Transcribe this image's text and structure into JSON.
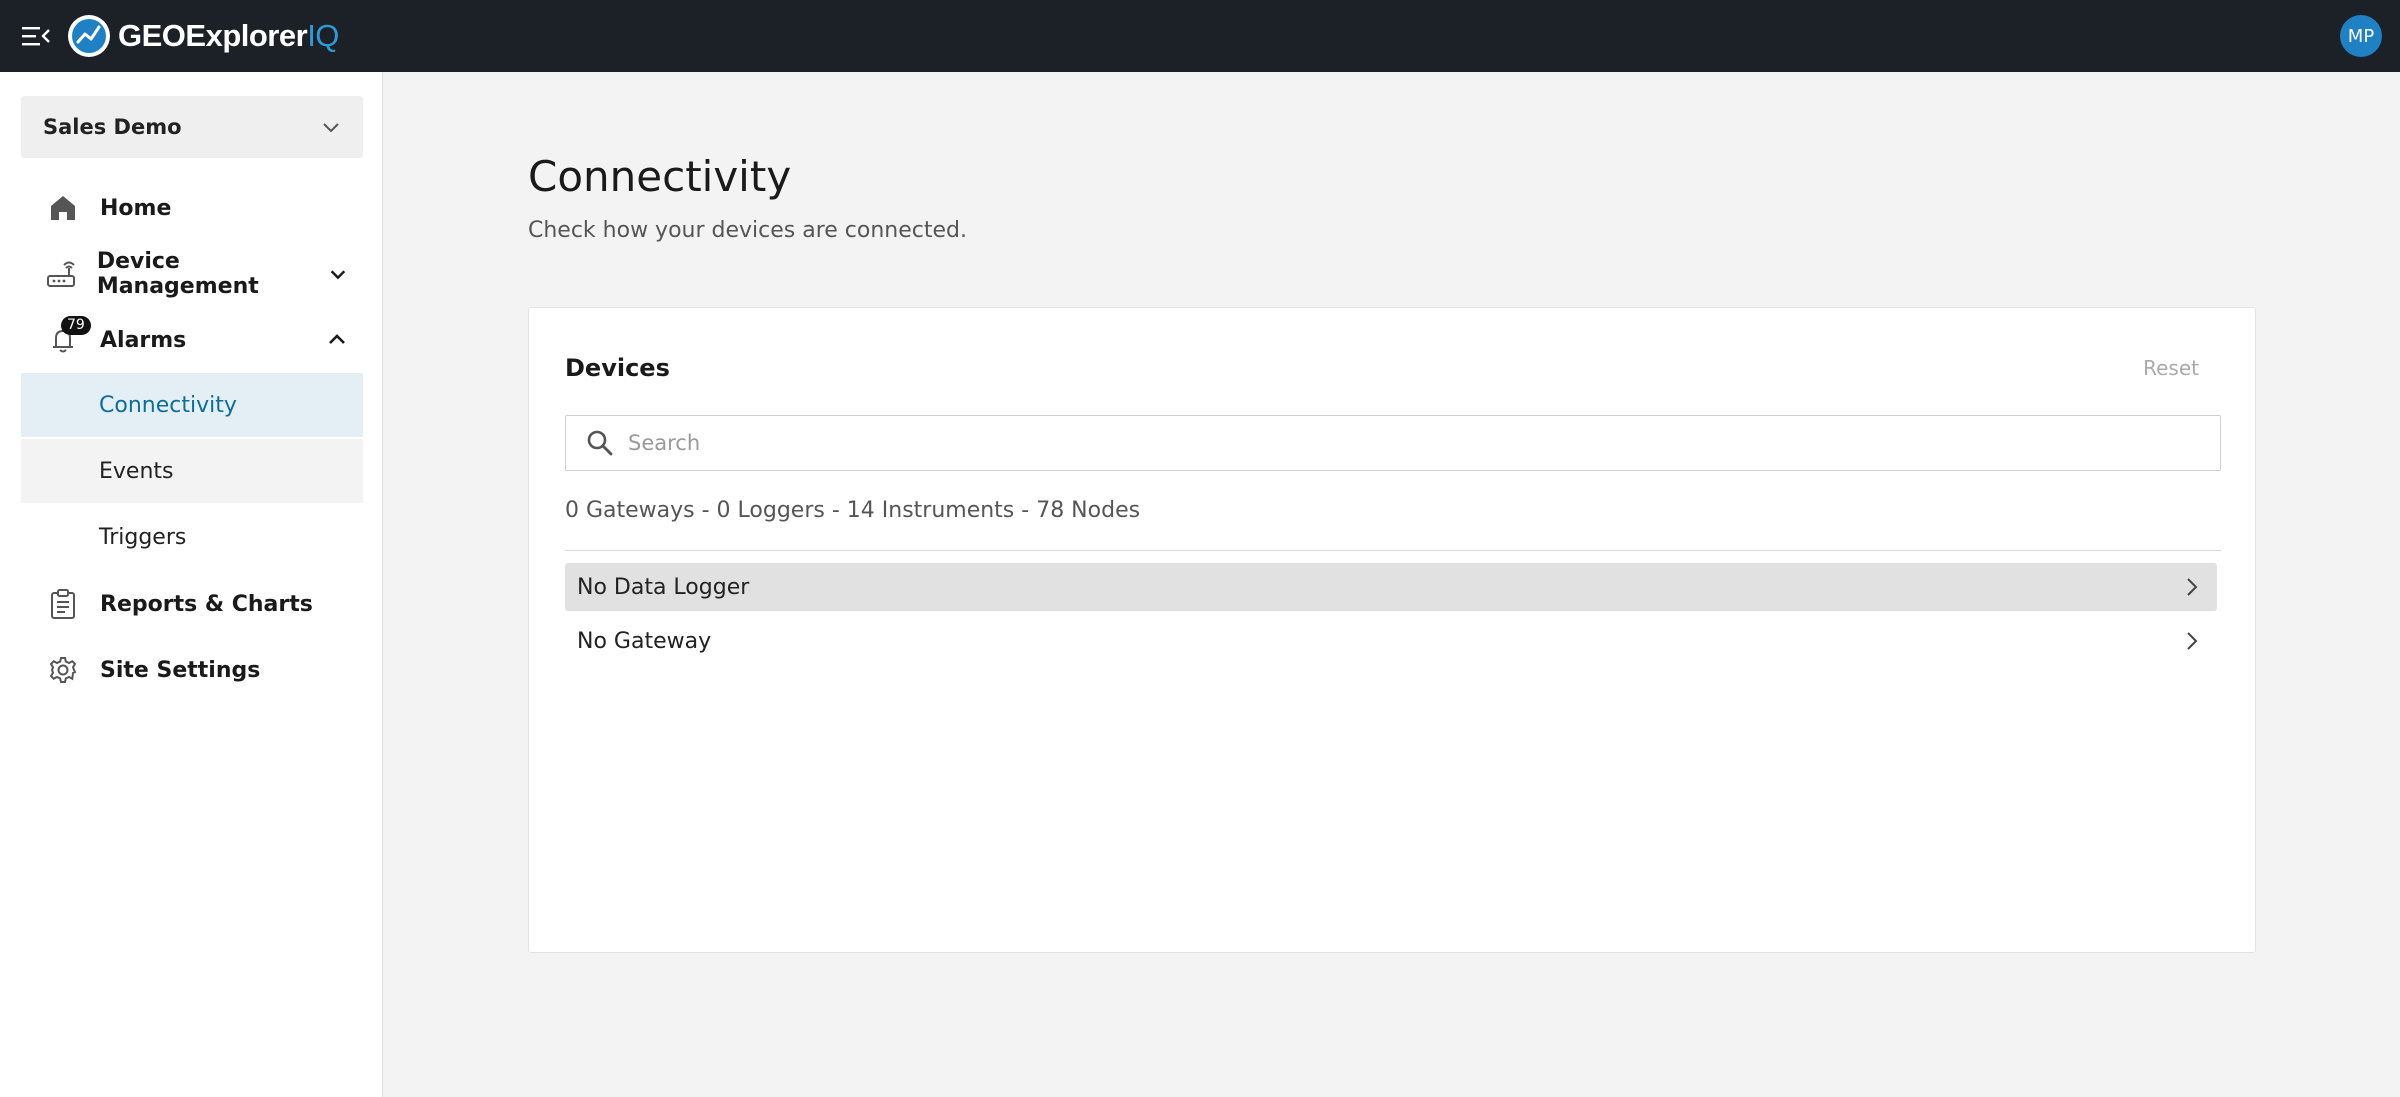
{
  "header": {
    "brand_main": "GEOExplorer",
    "brand_suffix": "IQ",
    "avatar_initials": "MP",
    "brand_color": "#2e9bd6",
    "avatar_color": "#1f80c4"
  },
  "sidebar": {
    "site_selector": "Sales Demo",
    "items": [
      {
        "label": "Home",
        "icon": "home-icon"
      },
      {
        "label": "Device Management",
        "icon": "router-icon"
      },
      {
        "label": "Alarms",
        "icon": "bell-icon",
        "badge": "79"
      },
      {
        "label": "Reports & Charts",
        "icon": "clipboard-icon"
      },
      {
        "label": "Site Settings",
        "icon": "gear-icon"
      }
    ],
    "alarm_subitems": [
      "Connectivity",
      "Events",
      "Triggers"
    ]
  },
  "main": {
    "title": "Connectivity",
    "subtitle": "Check how your devices are connected.",
    "card": {
      "title": "Devices",
      "reset_label": "Reset",
      "search_placeholder": "Search",
      "counts": "0 Gateways - 0 Loggers - 14 Instruments - 78 Nodes",
      "rows": [
        "No Data Logger",
        "No Gateway"
      ]
    }
  }
}
